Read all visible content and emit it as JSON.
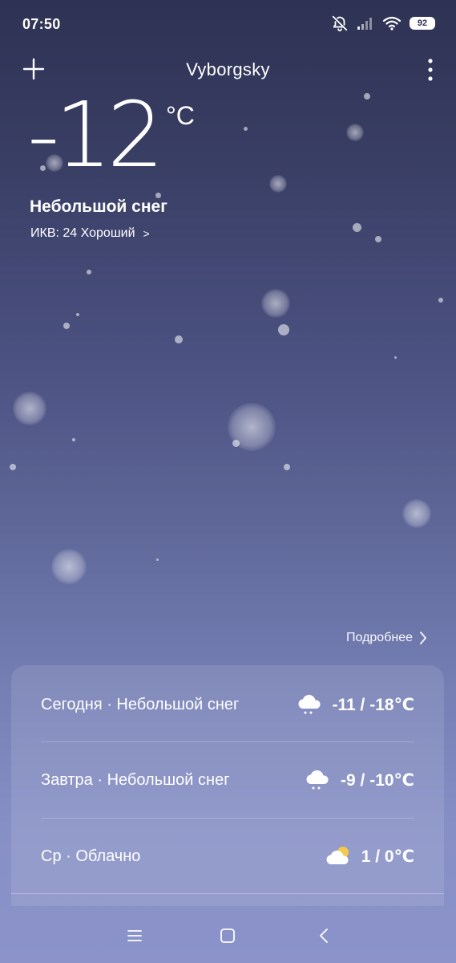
{
  "status_bar": {
    "time": "07:50",
    "battery": "92",
    "icons": [
      "bell-off-icon",
      "signal-icon",
      "wifi-icon",
      "battery-icon"
    ]
  },
  "header": {
    "city": "Vyborgsky",
    "add_icon": "plus-icon",
    "menu_icon": "more-vertical-icon"
  },
  "current": {
    "temperature": "-12",
    "unit": "°C",
    "condition": "Небольшой снег",
    "aqi_label": "ИКВ: 24 Хороший",
    "aqi_arrow": ">"
  },
  "more_link": {
    "label": "Подробнее",
    "icon": "chevron-right-icon"
  },
  "forecast": [
    {
      "label": "Сегодня · Небольшой снег",
      "icon": "snow-cloud-icon",
      "range": "-11 / -18℃"
    },
    {
      "label": "Завтра · Небольшой снег",
      "icon": "snow-cloud-icon",
      "range": "-9 / -10℃"
    },
    {
      "label": "Ср · Облачно",
      "icon": "partly-cloudy-icon",
      "range": "1 / 0℃"
    }
  ],
  "nav": {
    "icons": [
      "menu-icon",
      "home-square-icon",
      "back-chevron-icon"
    ]
  },
  "colors": {
    "bg_top": "#2e3253",
    "bg_bottom": "#8b93ca",
    "sun": "#f5c94a"
  }
}
